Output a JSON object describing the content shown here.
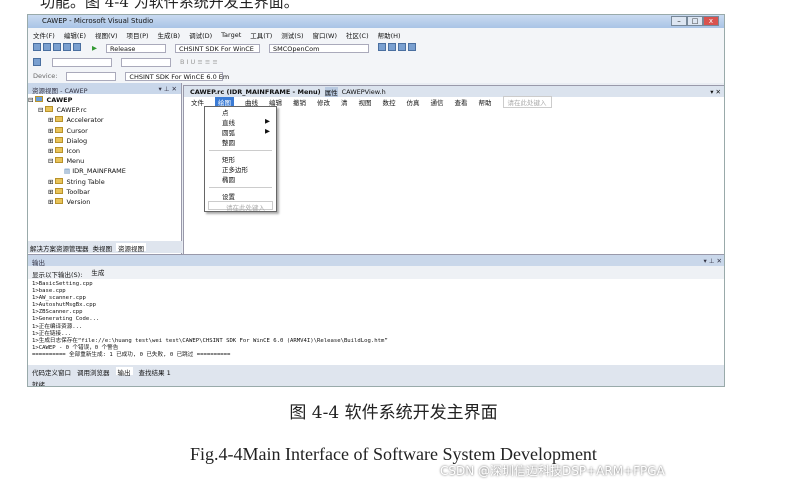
{
  "doc": {
    "top_text": "功能。图 4-4 为软件系统开发主界面。",
    "caption_cn": "图 4-4  软件系统开发主界面",
    "caption_en": "Fig.4-4Main Interface of Software System Development",
    "watermark": "CSDN @深圳信迈科技DSP+ARM+FPGA"
  },
  "window": {
    "title": "CAWEP - Microsoft Visual Studio"
  },
  "menu": [
    "文件(F)",
    "编辑(E)",
    "视图(V)",
    "项目(P)",
    "生成(B)",
    "调试(D)",
    "Target",
    "工具(T)",
    "测试(S)",
    "窗口(W)",
    "社区(C)",
    "帮助(H)"
  ],
  "toolbar": {
    "config": "Release",
    "platform": "CHSINT SDK For WinCE",
    "find": "SMCOpenCom",
    "device_label": "Device:",
    "device_sdk": "CHSINT SDK For WinCE 6.0 Em"
  },
  "left": {
    "title": "资源视图 - CAWEP",
    "root": "CAWEP",
    "rc": "CAWEP.rc",
    "items": [
      "Accelerator",
      "Cursor",
      "Dialog",
      "Icon",
      "Menu",
      "IDR_MAINFRAME",
      "String Table",
      "Toolbar",
      "Version"
    ],
    "tabs": [
      "解决方案资源管理器",
      "类视图",
      "资源视图"
    ]
  },
  "editor": {
    "tabs": [
      "CAWEP.rc (IDR_MAINFRAME - Menu)",
      "属性",
      "CAWEPView.h"
    ],
    "menu": [
      "文件",
      "绘图",
      "曲线",
      "编辑",
      "撤销",
      "修改",
      "清",
      "视图",
      "数控",
      "仿真",
      "通信",
      "查看",
      "帮助"
    ],
    "type_here": "请在此处键入",
    "dropdown": [
      "点",
      "直线",
      "圆弧",
      "整圆",
      "矩形",
      "正多边形",
      "椭圆",
      "设置"
    ]
  },
  "output": {
    "title": "输出",
    "show_label": "显示以下输出(S):",
    "source": "生成",
    "lines": [
      "1>BasicSetting.cpp",
      "1>base.cpp",
      "1>AW_scanner.cpp",
      "1>AutoshutMsgBx.cpp",
      "1>ZBScanner.cpp",
      "1>Generating Code...",
      "1>正在编译资源...",
      "1>正在链接...",
      "1>生成日志保存在“file://e:\\huang test\\wei test\\CAWEP\\CHSINT SDK For WinCE 6.0 (ARMV4I)\\Release\\BuildLog.htm”",
      "1>CAWEP - 0 个错误，0 个警告",
      "========== 全部重新生成: 1 已成功, 0 已失败, 0 已跳过 =========="
    ],
    "tabs": [
      "代码定义窗口",
      "调用浏览器",
      "输出",
      "查找结果 1"
    ]
  },
  "status": "就绪"
}
